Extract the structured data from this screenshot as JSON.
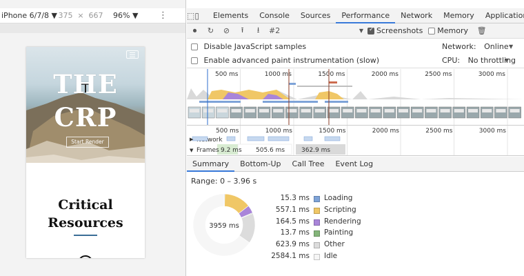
{
  "device_toolbar": {
    "device": "iPhone 6/7/8 ▼",
    "width": "375",
    "times": "×",
    "height": "667",
    "zoom": "96% ▼"
  },
  "page": {
    "title_line1": "THE",
    "title_line2": "CRP",
    "cta": "Start Render",
    "heading_line1": "Critical",
    "heading_line2": "Resources"
  },
  "devtools": {
    "tabs": [
      {
        "label": "Elements"
      },
      {
        "label": "Console"
      },
      {
        "label": "Sources"
      },
      {
        "label": "Performance"
      },
      {
        "label": "Network"
      },
      {
        "label": "Memory"
      },
      {
        "label": "Application"
      }
    ],
    "active_tab": "Performance"
  },
  "perf_toolbar": {
    "profile": "#2",
    "screenshots_label": "Screenshots",
    "memory_label": "Memory"
  },
  "settings": {
    "disable_js": "Disable JavaScript samples",
    "paint_instr": "Enable advanced paint instrumentation (slow)",
    "network_label": "Network:",
    "network_value": "Online",
    "cpu_label": "CPU:",
    "cpu_value": "No throttling"
  },
  "overview_ticks": [
    "500 ms",
    "1000 ms",
    "1500 ms",
    "2000 ms",
    "2500 ms",
    "3000 ms"
  ],
  "timing_ticks": [
    "500 ms",
    "1000 ms",
    "1500 ms",
    "2000 ms",
    "2500 ms",
    "3000 ms"
  ],
  "tracks": {
    "network": "Network",
    "frames": "Frames",
    "frame_durations": [
      "9.2 ms",
      "505.6 ms",
      "362.9 ms"
    ]
  },
  "summary_tabs": [
    {
      "label": "Summary"
    },
    {
      "label": "Bottom-Up"
    },
    {
      "label": "Call Tree"
    },
    {
      "label": "Event Log"
    }
  ],
  "summary": {
    "range": "Range: 0 – 3.96 s",
    "total": "3959 ms",
    "items": [
      {
        "value": "15.3 ms",
        "label": "Loading",
        "ms": 15.3,
        "color": "#7ea3d8"
      },
      {
        "value": "557.1 ms",
        "label": "Scripting",
        "ms": 557.1,
        "color": "#f0c766"
      },
      {
        "value": "164.5 ms",
        "label": "Rendering",
        "ms": 164.5,
        "color": "#a985d9"
      },
      {
        "value": "13.7 ms",
        "label": "Painting",
        "ms": 13.7,
        "color": "#84b57a"
      },
      {
        "value": "623.9 ms",
        "label": "Other",
        "ms": 623.9,
        "color": "#dcdcdc"
      },
      {
        "value": "2584.1 ms",
        "label": "Idle",
        "ms": 2584.1,
        "color": "#f6f6f6"
      }
    ]
  }
}
